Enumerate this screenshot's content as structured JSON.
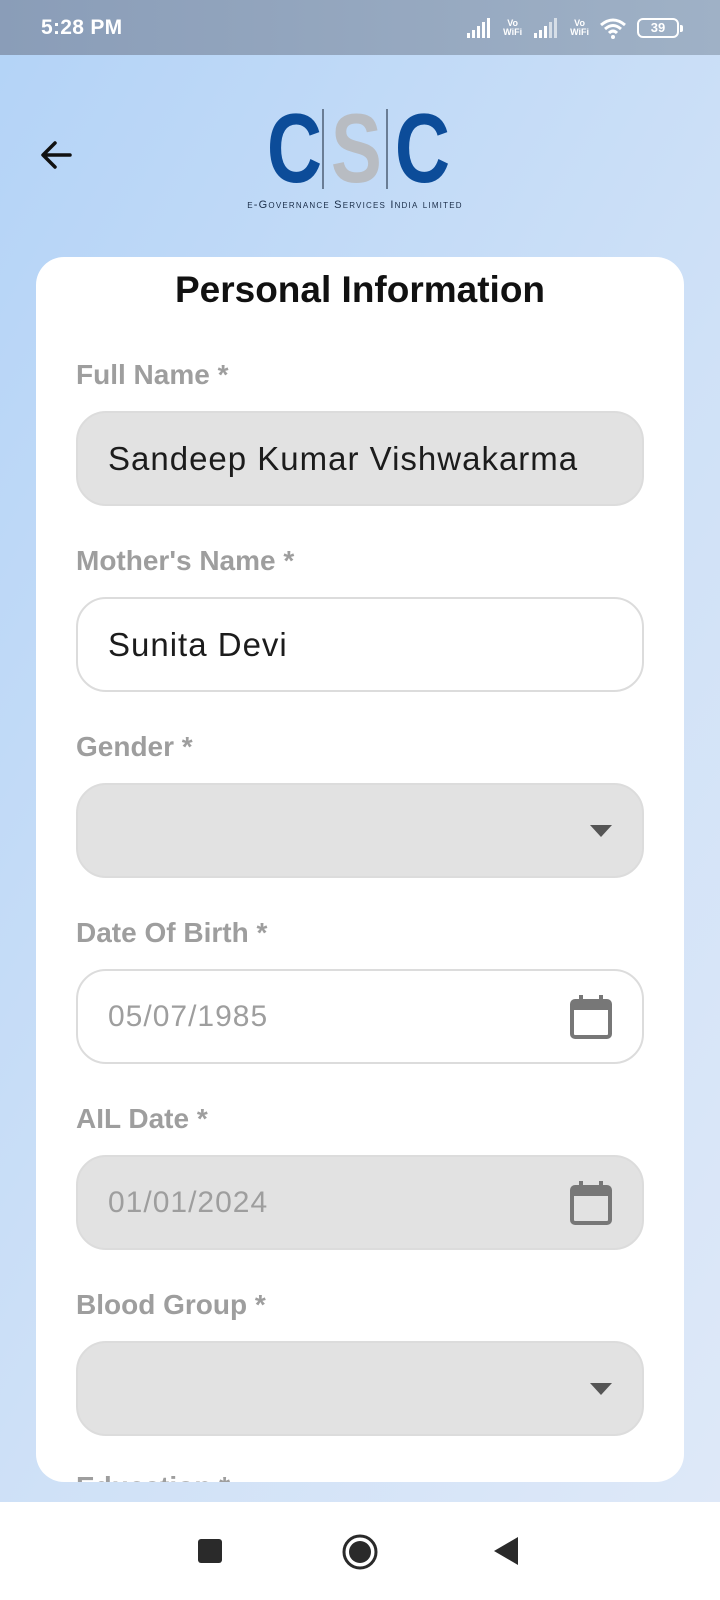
{
  "status_bar": {
    "time": "5:28 PM",
    "battery": "39",
    "vowifi_top": "Vo",
    "vowifi_bottom": "WiFi"
  },
  "header": {
    "logo": {
      "letters": [
        "C",
        "S",
        "C"
      ],
      "subtitle": "e-Governance Services India limited"
    }
  },
  "card": {
    "title": "Personal Information",
    "fields": [
      {
        "label": "Full Name *",
        "value": "Sandeep Kumar Vishwakarma",
        "style": "grey",
        "trailing": "none"
      },
      {
        "label": "Mother's Name *",
        "value": "Sunita Devi",
        "style": "white",
        "trailing": "none"
      },
      {
        "label": "Gender *",
        "value": "",
        "style": "grey",
        "trailing": "dropdown"
      },
      {
        "label": "Date Of Birth *",
        "value": "05/07/1985",
        "style": "white",
        "trailing": "calendar"
      },
      {
        "label": "AIL Date *",
        "value": "01/01/2024",
        "style": "grey",
        "trailing": "calendar"
      },
      {
        "label": "Blood Group *",
        "value": "",
        "style": "grey",
        "trailing": "dropdown"
      }
    ],
    "next_label": "Education *"
  },
  "colors": {
    "logo_blue": "#0c4c99",
    "logo_grey": "#b8bcc2",
    "label_grey": "#9e9e9e",
    "field_grey": "#e2e2e2"
  },
  "icons": {
    "back": "arrow-left-icon",
    "dropdown": "caret-down-icon",
    "calendar": "calendar-icon"
  }
}
